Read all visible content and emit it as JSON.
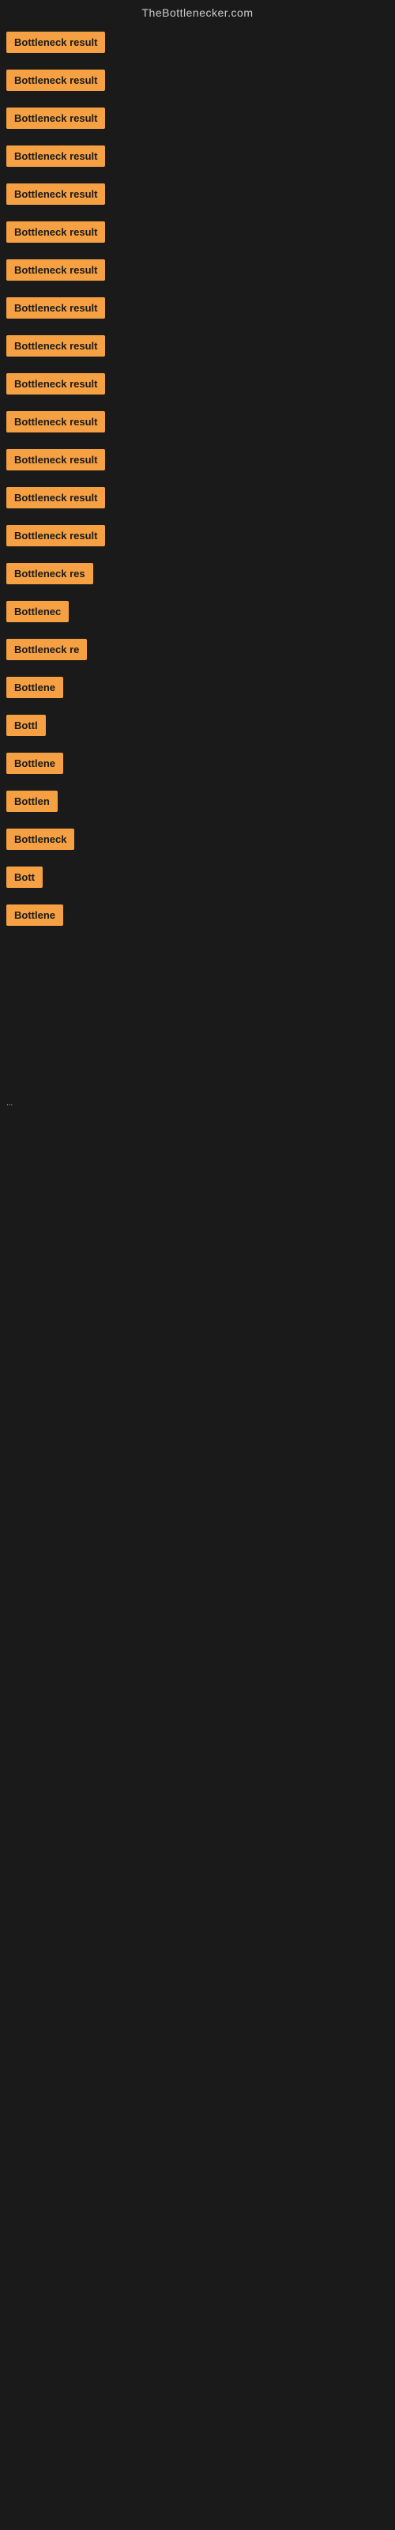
{
  "header": {
    "title": "TheBottlenecker.com"
  },
  "items": [
    {
      "label": "Bottleneck result",
      "width": 170
    },
    {
      "label": "Bottleneck result",
      "width": 170
    },
    {
      "label": "Bottleneck result",
      "width": 170
    },
    {
      "label": "Bottleneck result",
      "width": 170
    },
    {
      "label": "Bottleneck result",
      "width": 170
    },
    {
      "label": "Bottleneck result",
      "width": 170
    },
    {
      "label": "Bottleneck result",
      "width": 170
    },
    {
      "label": "Bottleneck result",
      "width": 170
    },
    {
      "label": "Bottleneck result",
      "width": 170
    },
    {
      "label": "Bottleneck result",
      "width": 170
    },
    {
      "label": "Bottleneck result",
      "width": 170
    },
    {
      "label": "Bottleneck result",
      "width": 170
    },
    {
      "label": "Bottleneck result",
      "width": 170
    },
    {
      "label": "Bottleneck result",
      "width": 170
    },
    {
      "label": "Bottleneck res",
      "width": 140
    },
    {
      "label": "Bottlenec",
      "width": 90
    },
    {
      "label": "Bottleneck re",
      "width": 120
    },
    {
      "label": "Bottlene",
      "width": 82
    },
    {
      "label": "Bottl",
      "width": 55
    },
    {
      "label": "Bottlene",
      "width": 82
    },
    {
      "label": "Bottlen",
      "width": 72
    },
    {
      "label": "Bottleneck",
      "width": 95
    },
    {
      "label": "Bott",
      "width": 48
    },
    {
      "label": "Bottlene",
      "width": 82
    }
  ],
  "dots": "...",
  "accent_color": "#f5a042"
}
